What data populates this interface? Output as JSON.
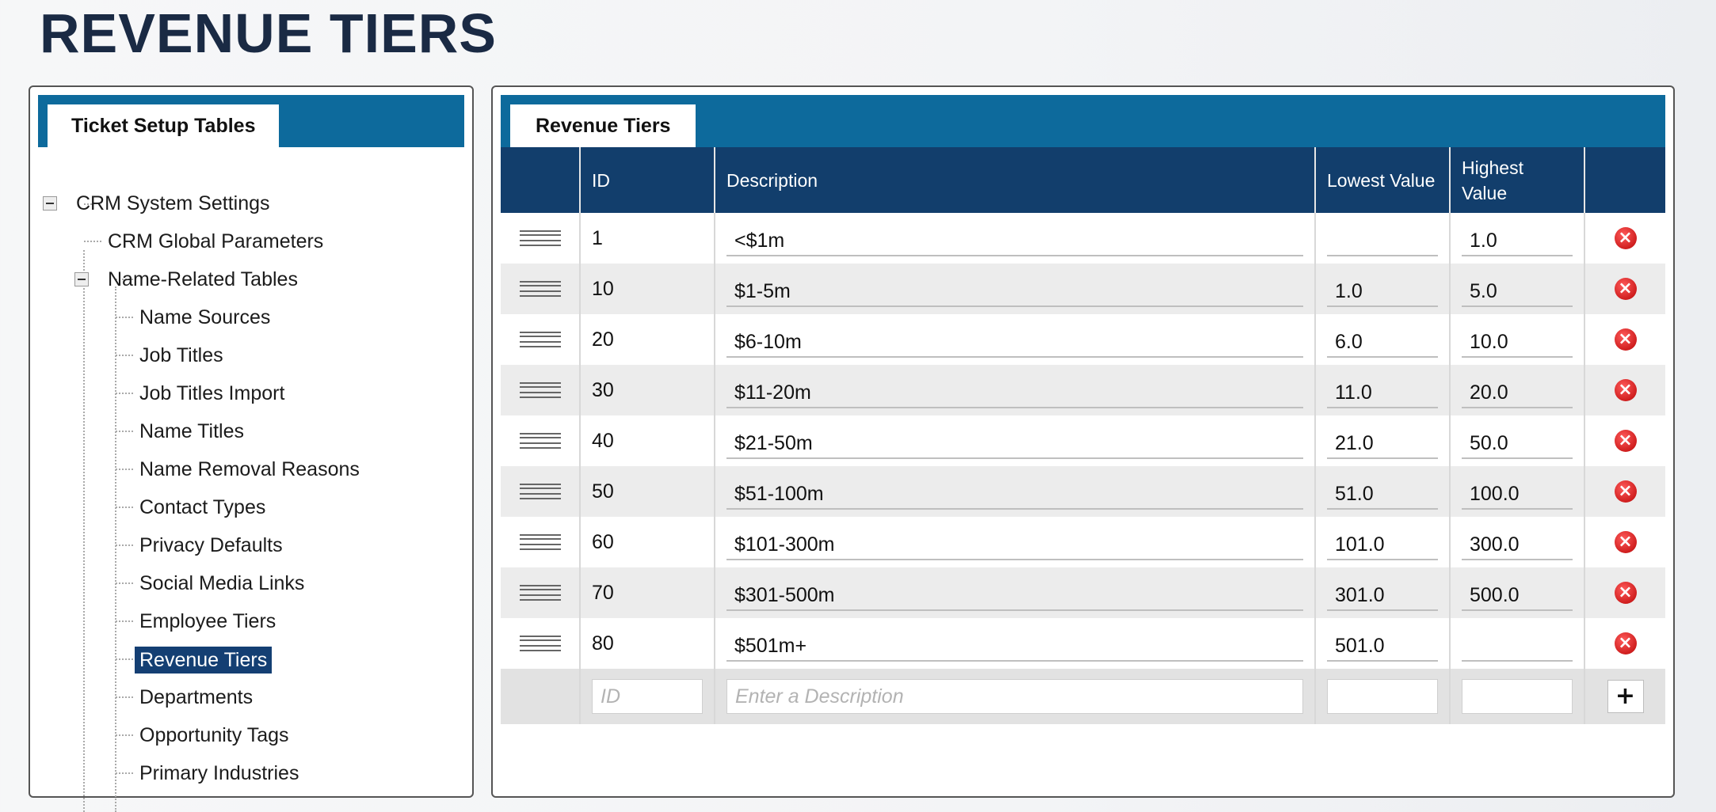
{
  "page": {
    "title": "REVENUE TIERS"
  },
  "left_panel": {
    "tab_label": "Ticket Setup Tables",
    "tree": {
      "root": "CRM System Settings",
      "global_params": "CRM Global Parameters",
      "group": "Name-Related Tables",
      "items": [
        "Name Sources",
        "Job Titles",
        "Job Titles Import",
        "Name Titles",
        "Name Removal Reasons",
        "Contact Types",
        "Privacy Defaults",
        "Social Media Links",
        "Employee Tiers",
        "Revenue Tiers",
        "Departments",
        "Opportunity Tags",
        "Primary Industries"
      ],
      "selected": "Revenue Tiers"
    }
  },
  "right_panel": {
    "tab_label": "Revenue Tiers",
    "columns": {
      "id": "ID",
      "description": "Description",
      "lowest": "Lowest Value",
      "highest": "Highest Value"
    },
    "rows": [
      {
        "id": "1",
        "description": "<$1m",
        "lowest": "",
        "highest": "1.0"
      },
      {
        "id": "10",
        "description": "$1-5m",
        "lowest": "1.0",
        "highest": "5.0"
      },
      {
        "id": "20",
        "description": "$6-10m",
        "lowest": "6.0",
        "highest": "10.0"
      },
      {
        "id": "30",
        "description": "$11-20m",
        "lowest": "11.0",
        "highest": "20.0"
      },
      {
        "id": "40",
        "description": "$21-50m",
        "lowest": "21.0",
        "highest": "50.0"
      },
      {
        "id": "50",
        "description": "$51-100m",
        "lowest": "51.0",
        "highest": "100.0"
      },
      {
        "id": "60",
        "description": "$101-300m",
        "lowest": "101.0",
        "highest": "300.0"
      },
      {
        "id": "70",
        "description": "$301-500m",
        "lowest": "301.0",
        "highest": "500.0"
      },
      {
        "id": "80",
        "description": "$501m+",
        "lowest": "501.0",
        "highest": ""
      }
    ],
    "new_row": {
      "id_placeholder": "ID",
      "description_placeholder": "Enter a Description",
      "add_label": "+"
    },
    "icons": {
      "delete": "delete-circle-icon",
      "drag": "drag-handle-icon"
    }
  },
  "colors": {
    "header_blue": "#0d6a9c",
    "column_header": "#123e6c",
    "selected": "#143f73",
    "delete_red": "#d01f1f"
  }
}
